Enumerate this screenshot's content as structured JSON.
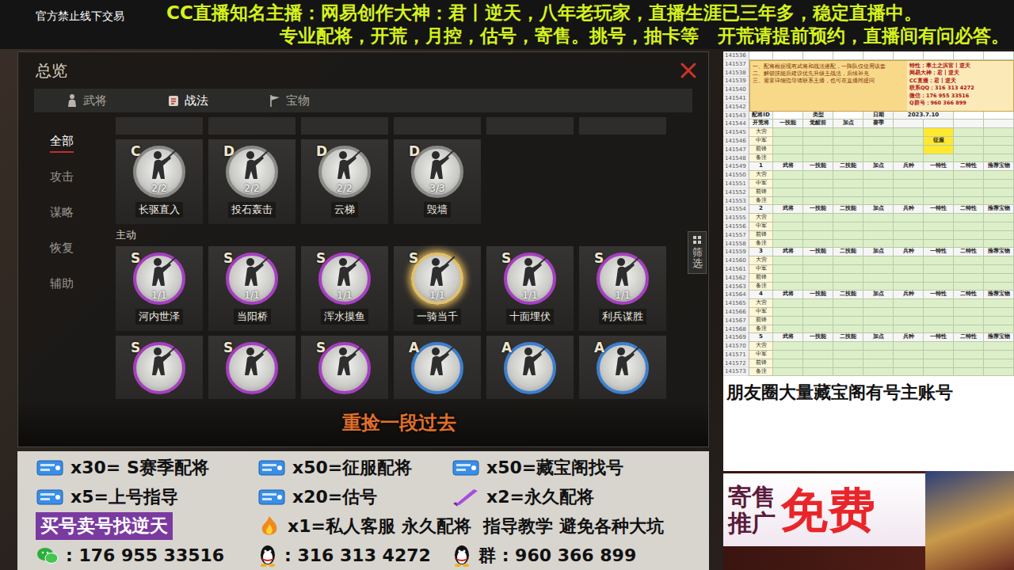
{
  "header": {
    "notice": "官方禁止线下交易",
    "line1": "CC直播知名主播：网易创作大神：君丨逆天，八年老玩家，直播生涯已三年多，稳定直播中。",
    "line2": "专业配将，开荒，月控，估号，寄售。挑号，抽卡等   开荒请提前预约，直播间有问必答。"
  },
  "game": {
    "title": "总览",
    "tabs": [
      {
        "label": "武将",
        "selected": false
      },
      {
        "label": "战法",
        "selected": true
      },
      {
        "label": "宝物",
        "selected": false
      }
    ],
    "sidebar": [
      {
        "label": "全部",
        "selected": true
      },
      {
        "label": "攻击",
        "selected": false
      },
      {
        "label": "谋略",
        "selected": false
      },
      {
        "label": "恢复",
        "selected": false
      },
      {
        "label": "辅助",
        "selected": false
      }
    ],
    "passive_cards": [
      {
        "grade": "C",
        "count": "2/2",
        "name": "长驱直入",
        "selected": false
      },
      {
        "grade": "D",
        "count": "2/2",
        "name": "投石轰击",
        "selected": false
      },
      {
        "grade": "D",
        "count": "2/2",
        "name": "云梯",
        "selected": false
      },
      {
        "grade": "D",
        "count": "3/3",
        "name": "毁墙",
        "selected": false
      }
    ],
    "section_label": "主动",
    "active_cards": [
      {
        "grade": "S",
        "count": "1/1",
        "name": "河内世泽",
        "selected": false
      },
      {
        "grade": "S",
        "count": "1/1",
        "name": "当阳桥",
        "selected": false
      },
      {
        "grade": "S",
        "count": "1/1",
        "name": "浑水摸鱼",
        "selected": false
      },
      {
        "grade": "S",
        "count": "1/1",
        "name": "一骑当千",
        "selected": true
      },
      {
        "grade": "S",
        "count": "1/1",
        "name": "十面埋伏",
        "selected": false
      },
      {
        "grade": "S",
        "count": "1/1",
        "name": "利兵谋胜",
        "selected": false
      }
    ],
    "partial_cards": [
      {
        "grade": "S"
      },
      {
        "grade": "S"
      },
      {
        "grade": "S"
      },
      {
        "grade": "A"
      },
      {
        "grade": "A"
      },
      {
        "grade": "A"
      }
    ],
    "filter": "筛选",
    "caption": "重捡一段过去"
  },
  "sheet": {
    "row_numbers": [
      "141536",
      "141537",
      "141538",
      "141539",
      "141540",
      "141541",
      "141542",
      "141543",
      "141544",
      "141545",
      "141546",
      "141547",
      "141548",
      "141549",
      "141550",
      "141551",
      "141552",
      "141553",
      "141554",
      "141555",
      "141556",
      "141557",
      "141558",
      "141559",
      "141560",
      "141561",
      "141562",
      "141563",
      "141564",
      "141565",
      "141566",
      "141567",
      "141568",
      "141569",
      "141570",
      "141571",
      "141572",
      "141573"
    ],
    "notes": [
      "一、配将根据现有武将和战法搭配，一阵队仅使用该套",
      "二、解锁技能后建议优先升级主战法，后续补充",
      "三、需要详细指导请联系主播，也可在直播间提问"
    ],
    "info": [
      "特性：率土之滨官丨逆天",
      "网易大神：君丨逆天",
      "CC直播：君丨逆天",
      "联系QQ：316 313 4272",
      "微信：176 955 33516",
      "Q群号：960 366 899"
    ],
    "id_row": {
      "label": "配将ID",
      "type": "类型",
      "date_label": "日期",
      "date": "2023.7.10"
    },
    "opening": {
      "headers": [
        "开荒将",
        "一技能",
        "觉醒前",
        "加点",
        "赛季"
      ],
      "rows": [
        "大营",
        "中军",
        "前锋",
        "备注"
      ],
      "season": "征服"
    },
    "sections": [
      {
        "num": "1",
        "headers": [
          "武将",
          "一技能",
          "二技能",
          "加点",
          "兵种",
          "一特性",
          "二特性",
          "推荐宝物"
        ],
        "rows": [
          "大营",
          "中军",
          "前锋",
          "备注"
        ]
      },
      {
        "num": "2",
        "headers": [
          "武将",
          "一技能",
          "二技能",
          "加点",
          "兵种",
          "一特性",
          "二特性",
          "推荐宝物"
        ],
        "rows": [
          "大营",
          "中军",
          "前锋",
          "备注"
        ]
      },
      {
        "num": "3",
        "headers": [
          "武将",
          "一技能",
          "二技能",
          "加点",
          "兵种",
          "一特性",
          "二特性",
          "推荐宝物"
        ],
        "rows": [
          "大营",
          "中军",
          "前锋",
          "备注"
        ]
      },
      {
        "num": "4",
        "headers": [
          "武将",
          "一技能",
          "二技能",
          "加点",
          "兵种",
          "一特性",
          "二特性",
          "推荐宝物"
        ],
        "rows": [
          "大营",
          "中军",
          "前锋",
          "备注"
        ]
      },
      {
        "num": "5",
        "headers": [
          "武将",
          "一技能",
          "二技能",
          "加点",
          "兵种",
          "一特性",
          "二特性",
          "推荐宝物"
        ],
        "rows": [
          "大营",
          "中军",
          "前锋",
          "备注"
        ]
      }
    ]
  },
  "friends_note": "朋友圈大量藏宝阁有号主账号",
  "promo": {
    "line1": "寄售",
    "line2": "推广",
    "big": "免费"
  },
  "prices": [
    {
      "text": "x30= S赛季配将",
      "kind": "ticket"
    },
    {
      "text": "x50=征服配将",
      "kind": "ticket"
    },
    {
      "text": "x50=藏宝阁找号",
      "kind": "ticket"
    },
    {
      "text": "x5=上号指导",
      "kind": "ticket"
    },
    {
      "text": "x20=估号",
      "kind": "ticket"
    },
    {
      "text": "x2=永久配将",
      "kind": "blade"
    }
  ],
  "buy_sell": "买号卖号找逆天",
  "service": {
    "text": "x1=私人客服 永久配将  指导教学 避免各种大坑",
    "kind": "flame"
  },
  "contacts": [
    {
      "kind": "wechat",
      "text": ": 176 955 33516"
    },
    {
      "kind": "qq",
      "text": ": 316 313 4272"
    },
    {
      "kind": "qq",
      "text": "群 : 960 366 899"
    }
  ]
}
